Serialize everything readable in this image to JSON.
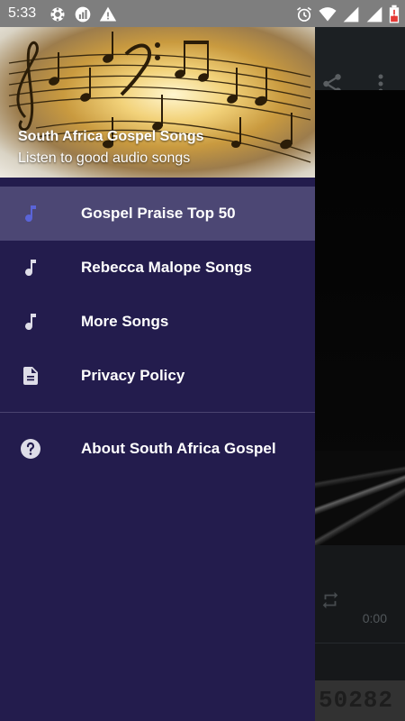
{
  "status_bar": {
    "time": "5:33",
    "left_icons": [
      "settings-icon",
      "data-usage-icon",
      "warning-icon"
    ],
    "right_icons": [
      "alarm-icon",
      "wifi-icon",
      "signal-icon",
      "signal-icon",
      "battery-low-icon"
    ]
  },
  "drawer": {
    "header": {
      "title": "South Africa Gospel Songs",
      "subtitle": "Listen to good audio songs"
    },
    "items": [
      {
        "label": "Gospel Praise Top 50",
        "icon": "music-note-icon",
        "active": true
      },
      {
        "label": "Rebecca Malope Songs",
        "icon": "music-note-icon",
        "active": false
      },
      {
        "label": "More Songs",
        "icon": "music-note-icon",
        "active": false
      },
      {
        "label": "Privacy Policy",
        "icon": "document-icon",
        "active": false
      }
    ],
    "footer_items": [
      {
        "label": "About South Africa Gospel",
        "icon": "help-icon"
      }
    ]
  },
  "background_app": {
    "toolbar_icons": [
      "share-icon",
      "more-vert-icon"
    ],
    "player": {
      "elapsed": "0:00"
    },
    "ticker_text": "50282"
  },
  "colors": {
    "drawer_bg": "#231c4d",
    "active_item_bg": "#4c4774",
    "active_icon": "#5a64d8",
    "inactive_icon": "#dedde8",
    "status_bar": "#7e7e7e"
  }
}
